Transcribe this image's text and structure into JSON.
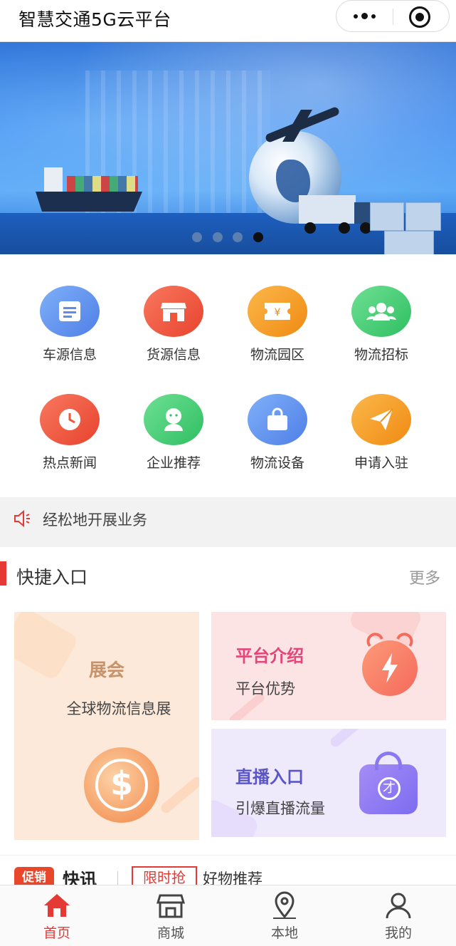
{
  "header": {
    "title": "智慧交通5G云平台"
  },
  "banner": {
    "slide_count": 4,
    "active_index": 3
  },
  "grid": {
    "items": [
      {
        "label": "车源信息",
        "icon": "document-icon",
        "color": "#5b8def"
      },
      {
        "label": "货源信息",
        "icon": "store-icon",
        "color": "#f0553a"
      },
      {
        "label": "物流园区",
        "icon": "ticket-icon",
        "color": "#f79a1f"
      },
      {
        "label": "物流招标",
        "icon": "group-icon",
        "color": "#3ec96f"
      },
      {
        "label": "热点新闻",
        "icon": "clock-icon",
        "color": "#f0553a"
      },
      {
        "label": "企业推荐",
        "icon": "person-icon",
        "color": "#3ec96f"
      },
      {
        "label": "物流设备",
        "icon": "bag-icon",
        "color": "#5b8def"
      },
      {
        "label": "申请入驻",
        "icon": "paper-plane-icon",
        "color": "#f79a1f"
      }
    ]
  },
  "notice": {
    "text": "经松地开展业务",
    "icon": "speaker-icon"
  },
  "quick": {
    "title": "快捷入口",
    "more": "更多",
    "expo": {
      "title": "展会",
      "subtitle": "全球物流信息展",
      "icon": "coin-icon"
    },
    "platform": {
      "title": "平台介绍",
      "subtitle": "平台优势",
      "icon": "alarm-clock-icon"
    },
    "live": {
      "title": "直播入口",
      "subtitle": "引爆直播流量",
      "icon": "shopping-bag-icon"
    }
  },
  "promo": {
    "badge": "促销",
    "news": "快讯",
    "limit": "限时抢",
    "goods": "好物推荐"
  },
  "tabbar": {
    "items": [
      {
        "label": "首页",
        "icon": "home-icon",
        "active": true
      },
      {
        "label": "商城",
        "icon": "shop-icon",
        "active": false
      },
      {
        "label": "本地",
        "icon": "location-icon",
        "active": false
      },
      {
        "label": "我的",
        "icon": "user-icon",
        "active": false
      }
    ],
    "active_color": "#e53935"
  }
}
